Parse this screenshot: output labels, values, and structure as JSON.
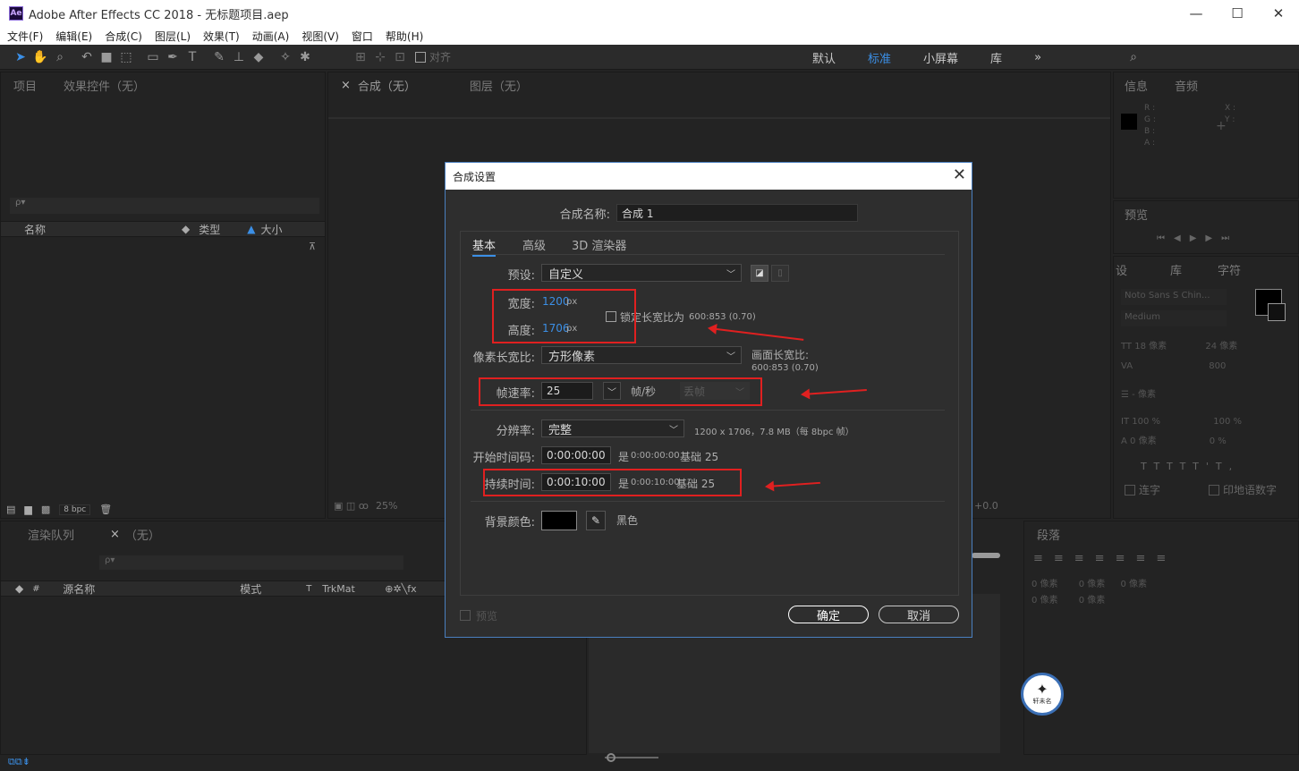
{
  "window": {
    "app_badge": "Ae",
    "title": "Adobe After Effects CC 2018 - 无标题项目.aep",
    "minimize": "—",
    "maximize": "☐",
    "close": "✕"
  },
  "menu": [
    "文件(F)",
    "编辑(E)",
    "合成(C)",
    "图层(L)",
    "效果(T)",
    "动画(A)",
    "视图(V)",
    "窗口",
    "帮助(H)"
  ],
  "toolbar": {
    "snap_label": "对齐",
    "workspaces": [
      "默认",
      "标准",
      "小屏幕",
      "库"
    ],
    "active_workspace": "标准"
  },
  "project_panel": {
    "tabs": [
      "项目",
      "效果控件（无）"
    ],
    "search_placeholder": "ρ▾",
    "columns": [
      "名称",
      "类型",
      "大小"
    ],
    "bpc": "8 bpc"
  },
  "comp_panel": {
    "tabs": [
      "合成（无）",
      "图层（无）"
    ],
    "zoom": "25%",
    "exposure": "+0.0"
  },
  "info_panel": {
    "tabs": [
      "信息",
      "音频"
    ],
    "rgb_labels": [
      "R :",
      "G :",
      "B :",
      "A :"
    ],
    "xy_labels": [
      "X :",
      "Y :"
    ]
  },
  "preview_panel": {
    "title": "预览"
  },
  "character_panel": {
    "tabs": [
      "设",
      "库",
      "字符"
    ],
    "font": "Noto Sans S Chin...",
    "style": "Medium",
    "size": "18 像素",
    "leading": "24 像素",
    "tracking": "800",
    "stroke": "- 像素",
    "vscale": "100 %",
    "hscale": "100 %",
    "baseline": "0 像素",
    "tsume": "0 %",
    "ligature": "连字",
    "hindi": "印地语数字"
  },
  "render_panel": {
    "tabs": [
      "渲染队列",
      "（无）"
    ],
    "columns": [
      "#",
      "源名称",
      "模式",
      "T",
      "TrkMat"
    ]
  },
  "paragraph_panel": {
    "title": "段落",
    "indents": [
      "0 像素",
      "0 像素",
      "0 像素",
      "0 像素",
      "0 像素"
    ]
  },
  "dialog": {
    "title": "合成设置",
    "comp_name_label": "合成名称:",
    "comp_name": "合成 1",
    "tabs": [
      "基本",
      "高级",
      "3D 渲染器"
    ],
    "preset_label": "预设:",
    "preset": "自定义",
    "width_label": "宽度:",
    "width": "1200",
    "height_label": "高度:",
    "height": "1706",
    "px": "px",
    "lock_label": "锁定长宽比为",
    "lock_ratio": "600:853 (0.70)",
    "pixel_aspect_label": "像素长宽比:",
    "pixel_aspect": "方形像素",
    "frame_aspect_label": "画面长宽比:",
    "frame_aspect": "600:853 (0.70)",
    "fps_label": "帧速率:",
    "fps": "25",
    "fps_unit": "帧/秒",
    "drop_frame": "丢帧",
    "resolution_label": "分辨率:",
    "resolution": "完整",
    "resolution_info": "1200 x 1706，7.8 MB（每 8bpc 帧）",
    "start_label": "开始时间码:",
    "start": "0:00:00:00",
    "start_is": "是",
    "start_is_val": "0:00:00:00",
    "start_base": "基础 25",
    "duration_label": "持续时间:",
    "duration": "0:00:10:00",
    "duration_is": "是",
    "duration_is_val": "0:00:10:00",
    "duration_base": "基础 25",
    "bg_label": "背景颜色:",
    "bg_name": "黑色",
    "bg_color": "#000000",
    "preview_label": "预览",
    "ok": "确定",
    "cancel": "取消"
  },
  "watermark": {
    "text": "轩未名"
  },
  "colors": {
    "accent": "#3b8fe6",
    "annotation": "#e02020"
  }
}
